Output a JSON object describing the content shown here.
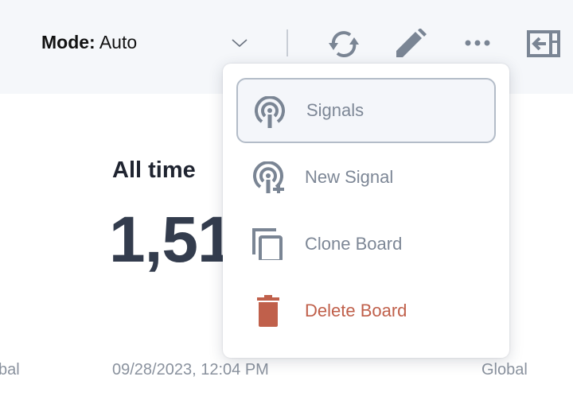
{
  "header": {
    "mode_label": "Mode:",
    "mode_value": "Auto",
    "icons": [
      "chevron-down-icon",
      "refresh-icon",
      "pencil-icon",
      "more-icon",
      "collapse-panel-icon"
    ]
  },
  "card": {
    "title": "All time",
    "value": "1,51"
  },
  "footer": {
    "left": "bal",
    "date": "09/28/2023, 12:04 PM",
    "scope": "Global"
  },
  "menu": {
    "items": [
      {
        "label": "Signals",
        "icon": "signal-icon",
        "selected": true
      },
      {
        "label": "New Signal",
        "icon": "signal-plus-icon"
      },
      {
        "label": "Clone Board",
        "icon": "copy-icon"
      },
      {
        "label": "Delete Board",
        "icon": "trash-icon",
        "color": "#c0604b"
      }
    ]
  },
  "colors": {
    "icon": "#7a8594",
    "danger": "#c0604b",
    "header_bg": "#f5f7fa"
  }
}
